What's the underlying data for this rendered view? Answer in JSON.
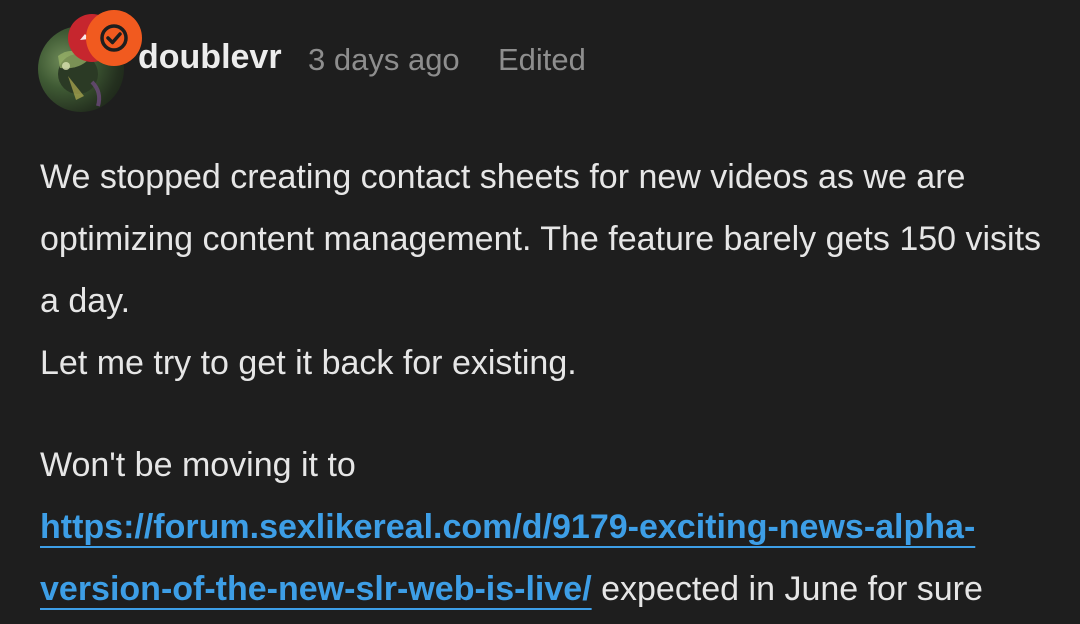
{
  "comment": {
    "author": "doublevr",
    "time": "3 days ago",
    "edited_label": "Edited",
    "paragraph1_line1": "We stopped creating contact sheets for new videos as we are optimizing content management. The feature barely gets 150 visits a day.",
    "paragraph1_line2": "Let me try to get it back for existing.",
    "paragraph2_prefix": "Won't be moving it to",
    "link_text": "https://forum.sexlikereal.com/d/9179-exciting-news-alpha-version-of-the-new-slr-web-is-live/",
    "paragraph2_suffix": "expected in June for sure"
  },
  "colors": {
    "background": "#1e1e1e",
    "link": "#3d9ee6",
    "muted": "#8e8e8e",
    "badge_orange": "#f15a1f",
    "badge_red": "#c6262e"
  },
  "icons": {
    "verified_badge": "check-circle-icon",
    "secondary_badge": "red-badge-icon"
  }
}
